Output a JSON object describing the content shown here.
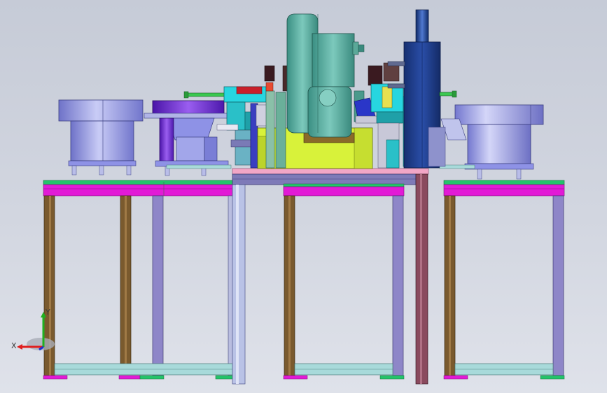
{
  "viewport": {
    "background_top": "#c6cbd7",
    "background_bottom": "#dfe2ea"
  },
  "palette": {
    "frame_top_green": "#23c46a",
    "frame_magenta": "#e21ad6",
    "leg_brown": "#7a5a2e",
    "leg_lavender": "#8e86c8",
    "leg_light": "#b9bde0",
    "bowl_blue": "#8e92e6",
    "bowl_purple": "#6c2ad2",
    "motor_teal": "#4fa89a",
    "press_navy": "#1c3a86",
    "base_yellow": "#d8f23a",
    "cyan_block": "#27d6e0",
    "pink_plate": "#f2a6c6"
  },
  "triad": {
    "x_label": "X",
    "y_label": "Y",
    "x_color": "#e02020",
    "y_color": "#20b020",
    "z_color": "#2030d0"
  }
}
